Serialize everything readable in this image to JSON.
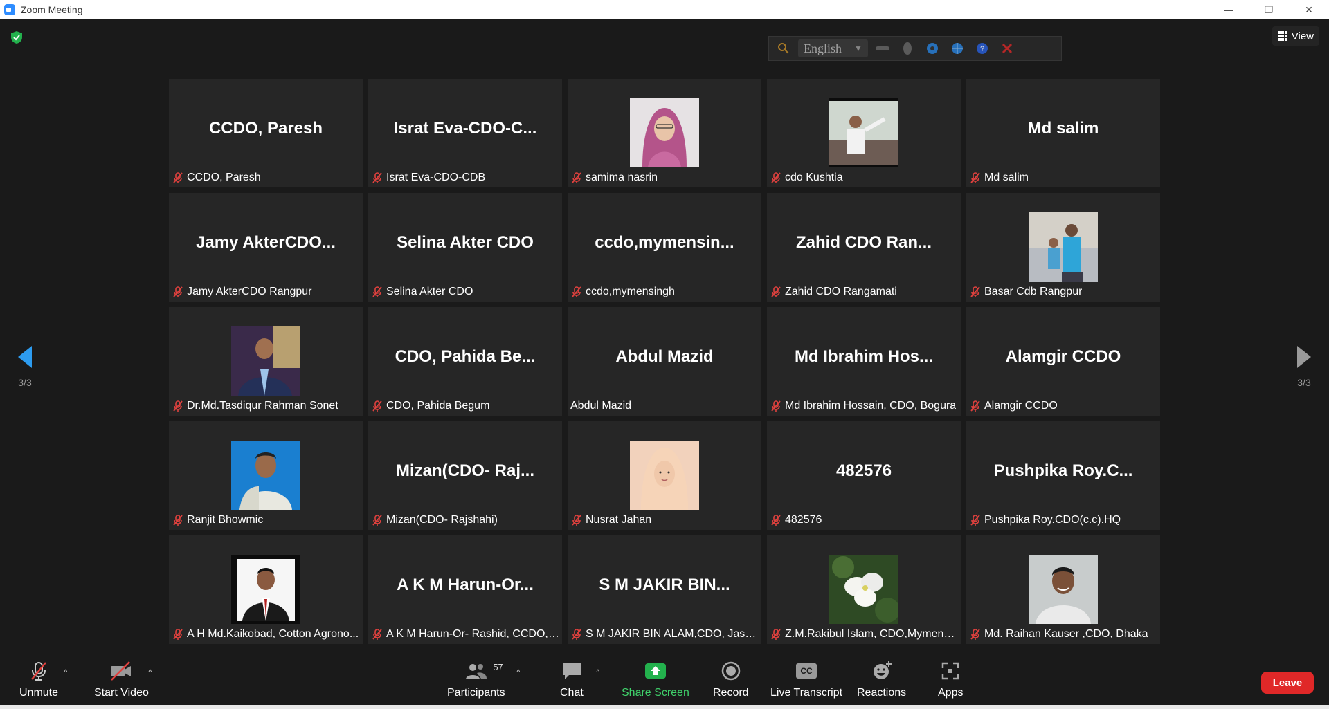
{
  "window": {
    "title": "Zoom Meeting",
    "minimize": "—",
    "restore": "❐",
    "close": "✕"
  },
  "view_label": "View",
  "language": {
    "current": "English"
  },
  "pagination": {
    "left": "3/3",
    "right": "3/3"
  },
  "tiles": [
    {
      "display": "CCDO, Paresh",
      "name": "CCDO, Paresh",
      "muted": true,
      "photo": null
    },
    {
      "display": "Israt  Eva-CDO-C...",
      "name": "Israt Eva-CDO-CDB",
      "muted": true,
      "photo": null
    },
    {
      "display": "",
      "name": "samima nasrin",
      "muted": true,
      "photo": "hijab-woman"
    },
    {
      "display": "",
      "name": "cdo Kushtia",
      "muted": true,
      "photo": "man-outdoor"
    },
    {
      "display": "Md salim",
      "name": "Md salim",
      "muted": true,
      "photo": null
    },
    {
      "display": "Jamy  AkterCDO...",
      "name": "Jamy AkterCDO Rangpur",
      "muted": true,
      "photo": null
    },
    {
      "display": "Selina Akter CDO",
      "name": "Selina Akter CDO",
      "muted": true,
      "photo": null
    },
    {
      "display": "ccdo,mymensin...",
      "name": "ccdo,mymensingh",
      "muted": true,
      "photo": null
    },
    {
      "display": "Zahid  CDO  Ran...",
      "name": "Zahid CDO Rangamati",
      "muted": true,
      "photo": null
    },
    {
      "display": "",
      "name": "Basar Cdb Rangpur",
      "muted": true,
      "photo": "man-child"
    },
    {
      "display": "",
      "name": "Dr.Md.Tasdiqur Rahman Sonet",
      "muted": true,
      "photo": "man-suit"
    },
    {
      "display": "CDO,  Pahida  Be...",
      "name": "CDO, Pahida Begum",
      "muted": true,
      "photo": null
    },
    {
      "display": "Abdul Mazid",
      "name": "Abdul Mazid",
      "muted": false,
      "photo": null
    },
    {
      "display": "Md  Ibrahim  Hos...",
      "name": "Md Ibrahim Hossain, CDO, Bogura",
      "muted": true,
      "photo": null
    },
    {
      "display": "Alamgir CCDO",
      "name": "Alamgir CCDO",
      "muted": true,
      "photo": null
    },
    {
      "display": "",
      "name": "Ranjit Bhowmic",
      "muted": true,
      "photo": "man-blue"
    },
    {
      "display": "Mizan(CDO-  Raj...",
      "name": "Mizan(CDO- Rajshahi)",
      "muted": true,
      "photo": null
    },
    {
      "display": "",
      "name": "Nusrat Jahan",
      "muted": true,
      "photo": "hijab-peach"
    },
    {
      "display": "482576",
      "name": "482576",
      "muted": true,
      "photo": null
    },
    {
      "display": "Pushpika  Roy.C...",
      "name": "Pushpika Roy.CDO(c.c).HQ",
      "muted": true,
      "photo": null
    },
    {
      "display": "",
      "name": "A H Md.Kaikobad, Cotton Agrono...",
      "muted": true,
      "photo": "man-tie"
    },
    {
      "display": "A  K  M  Harun-Or...",
      "name": "A K M Harun-Or- Rashid, CCDO, T...",
      "muted": true,
      "photo": null
    },
    {
      "display": "S  M  JAKIR  BIN...",
      "name": "S M JAKIR BIN ALAM,CDO, Jashore",
      "muted": true,
      "photo": null
    },
    {
      "display": "",
      "name": "Z.M.Rakibul Islam, CDO,Mymensin...",
      "muted": true,
      "photo": "flower"
    },
    {
      "display": "",
      "name": "Md. Raihan Kauser ,CDO, Dhaka",
      "muted": true,
      "photo": "man-smile"
    }
  ],
  "toolbar": {
    "unmute": "Unmute",
    "start_video": "Start Video",
    "participants": "Participants",
    "participants_count": "57",
    "chat": "Chat",
    "share_screen": "Share Screen",
    "record": "Record",
    "live_transcript": "Live Transcript",
    "cc_glyph": "CC",
    "reactions": "Reactions",
    "apps": "Apps",
    "leave": "Leave",
    "caret": "^"
  },
  "colors": {
    "accent_green": "#3fd06a",
    "leave_red": "#e02828",
    "arrow_blue": "#2d9cf0",
    "muted_red": "#e0413e"
  }
}
